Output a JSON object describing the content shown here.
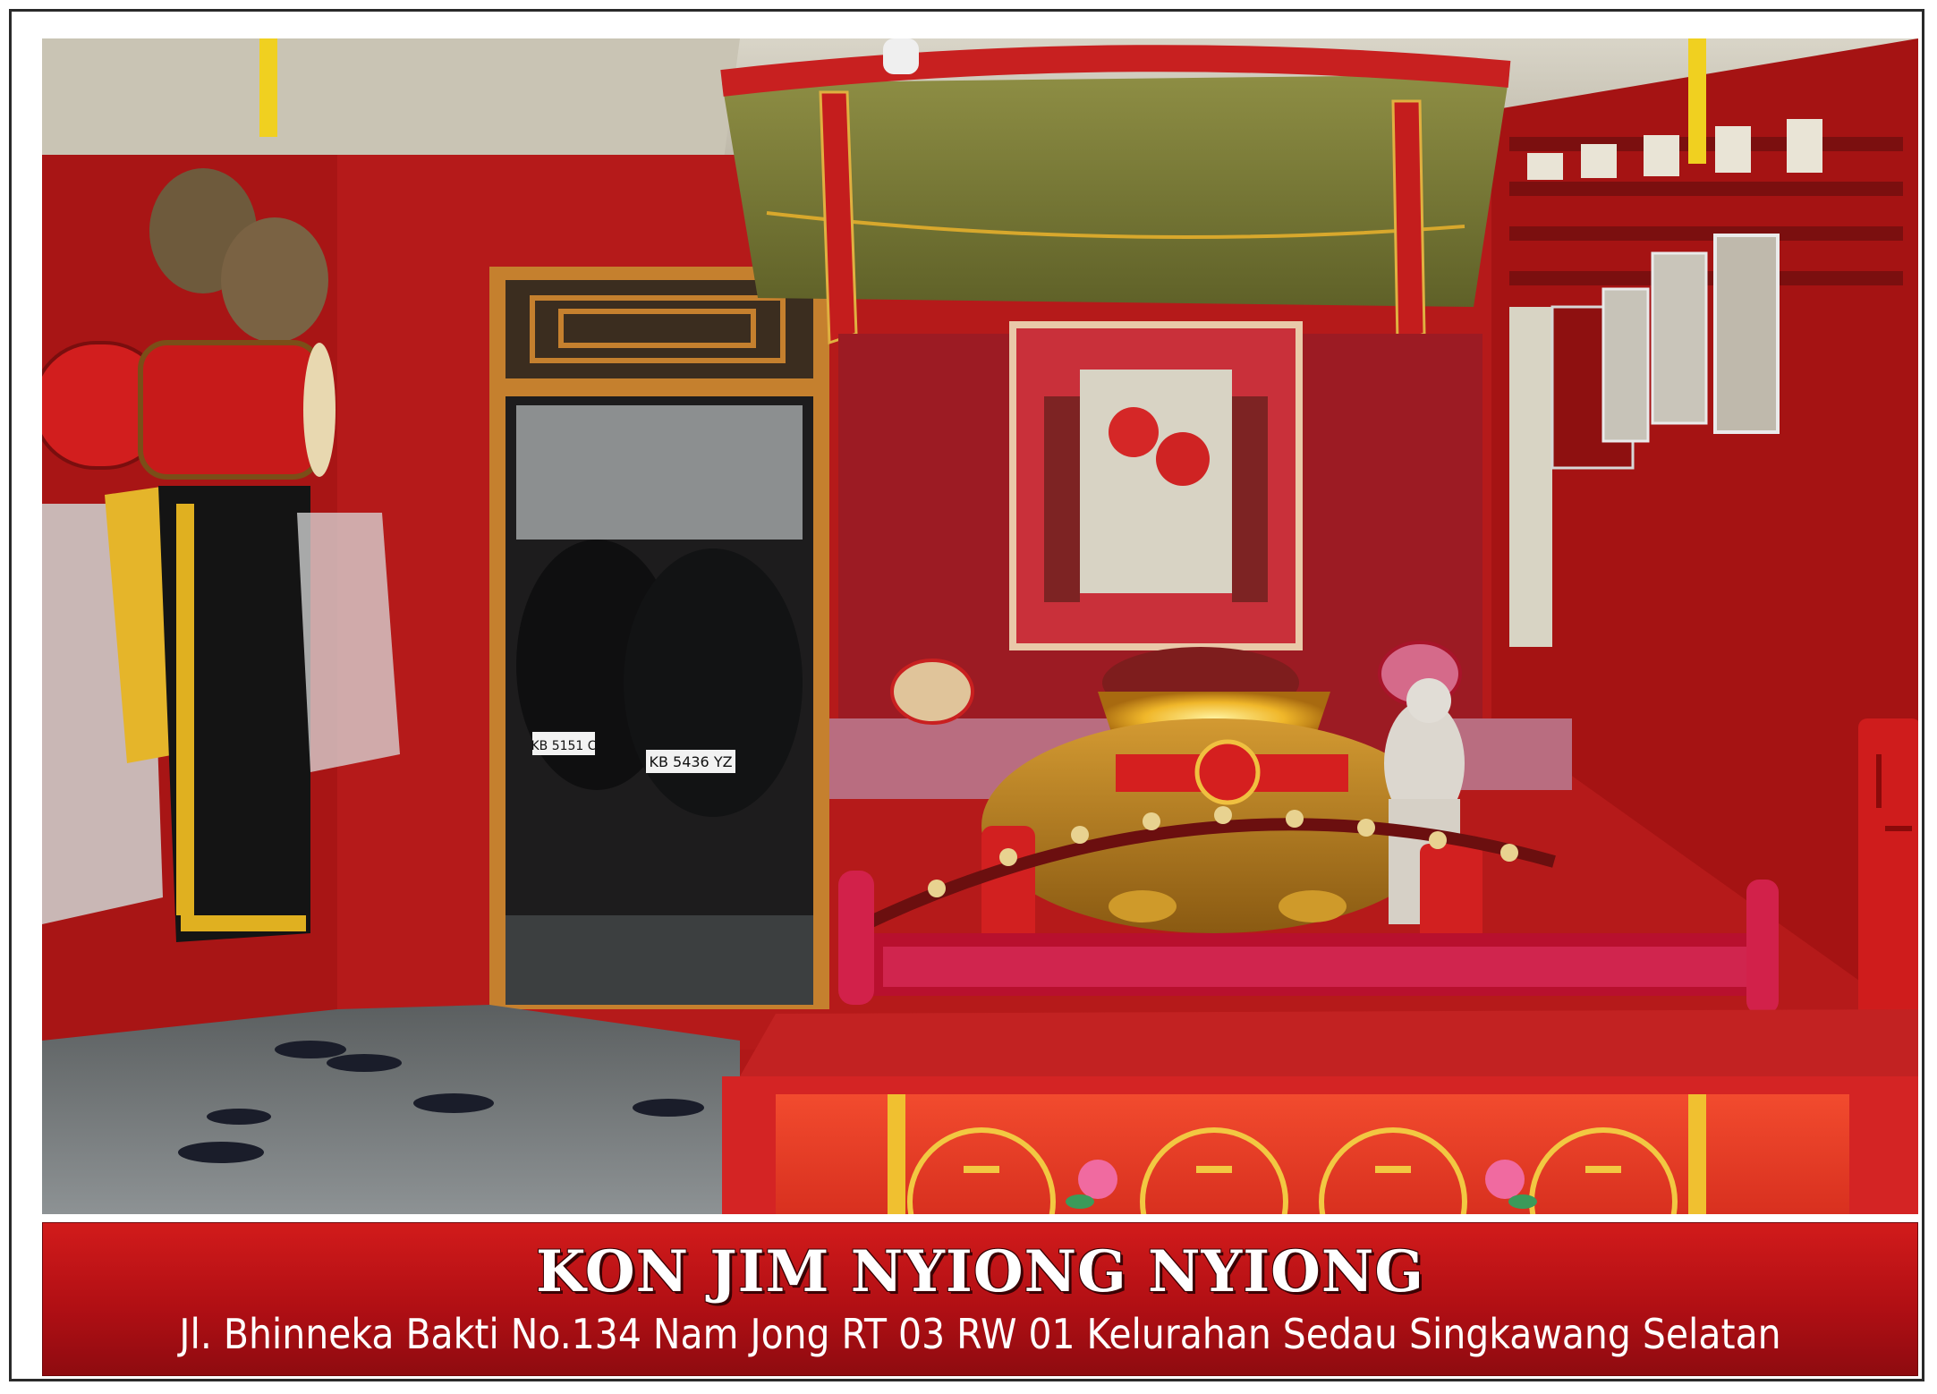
{
  "postcard": {
    "title": "KON JIM NYIONG NYIONG",
    "address": "Jl. Bhinneka Bakti No.134 Nam Jong  RT 03 RW 01 Kelurahan Sedau Singkawang Selatan"
  },
  "photo": {
    "subject": "temple-altar-interior",
    "license_plates": [
      "KB 5436 YZ",
      "KB 5151 C"
    ]
  },
  "colors": {
    "caption_band": "#b10f14",
    "wall_red": "#b01818",
    "canopy_olive": "#6f7030"
  }
}
